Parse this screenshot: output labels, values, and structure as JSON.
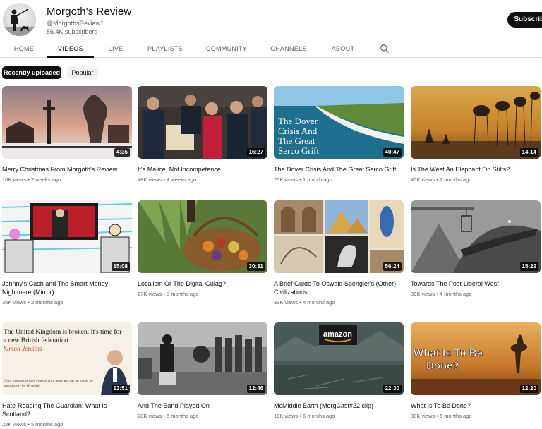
{
  "channel": {
    "name": "Morgoth's Review",
    "handle": "@MorgothsReview1",
    "subscribers": "56.4K subscribers",
    "subscribe_label": "Subscribe"
  },
  "tabs": [
    {
      "label": "HOME"
    },
    {
      "label": "VIDEOS"
    },
    {
      "label": "LIVE"
    },
    {
      "label": "PLAYLISTS"
    },
    {
      "label": "COMMUNITY"
    },
    {
      "label": "CHANNELS"
    },
    {
      "label": "ABOUT"
    }
  ],
  "active_tab": "VIDEOS",
  "filters": [
    {
      "label": "Recently uploaded",
      "active": true
    },
    {
      "label": "Popular",
      "active": false
    }
  ],
  "videos": [
    {
      "title": "Merry Christmas From Morgoth's Review",
      "duration": "4:35",
      "views": "10K views",
      "age": "2 weeks ago"
    },
    {
      "title": "It's Malice, Not Incompetence",
      "duration": "16:27",
      "views": "48K views",
      "age": "4 weeks ago"
    },
    {
      "title": "The Dover Crisis And The Great Serco Grift",
      "duration": "40:47",
      "views": "25K views",
      "age": "1 month ago",
      "thumb_text": [
        "The Dover",
        "Crisis And",
        "The Great",
        "Serco Grift"
      ]
    },
    {
      "title": "Is The West An Elephant On Stilts?",
      "duration": "14:14",
      "views": "45K views",
      "age": "2 months ago"
    },
    {
      "title": "Johnny's Cash and The Smart Money Nightmare (Mirror)",
      "duration": "15:08",
      "views": "36K views",
      "age": "2 months ago"
    },
    {
      "title": "Localism Or The Digital Gulag?",
      "duration": "30:31",
      "views": "27K views",
      "age": "3 months ago"
    },
    {
      "title": "A Brief Guide To Oswald Spengler's (Other) Civilizations",
      "duration": "56:24",
      "views": "33K views",
      "age": "4 months ago"
    },
    {
      "title": "Towards The Post-Liberal West",
      "duration": "15:29",
      "views": "38K views",
      "age": "4 months ago"
    },
    {
      "title": "Hate-Reading The Guardian: What Is Scotland?",
      "duration": "13:51",
      "views": "22K views",
      "age": "5 months ago",
      "thumb_text": [
        "The United Kingdom is broken. It's time for",
        "a new British federation",
        "Simon Jenkins",
        "Celtic grievances have erupted once more and can no longer be",
        "waved away by Whitehall"
      ]
    },
    {
      "title": "And The Band Played On",
      "duration": "12:46",
      "views": "28K views",
      "age": "5 months ago"
    },
    {
      "title": "McMiddle Earth (MorgCast#22 clip)",
      "duration": "22:30",
      "views": "19K views",
      "age": "6 months ago",
      "thumb_text": [
        "amazon"
      ]
    },
    {
      "title": "What Is To Be Done?",
      "duration": "12:20",
      "views": "38K views",
      "age": "6 months ago",
      "thumb_text": [
        "What Is To Be",
        "Done?"
      ]
    }
  ],
  "meta_separator": "•",
  "colors": {
    "accent": "#0f0f0f",
    "meta": "#606060",
    "chip_bg": "#f2f2f2",
    "divider": "#e5e5e5"
  },
  "icons": {
    "tab_search": "search-icon"
  }
}
